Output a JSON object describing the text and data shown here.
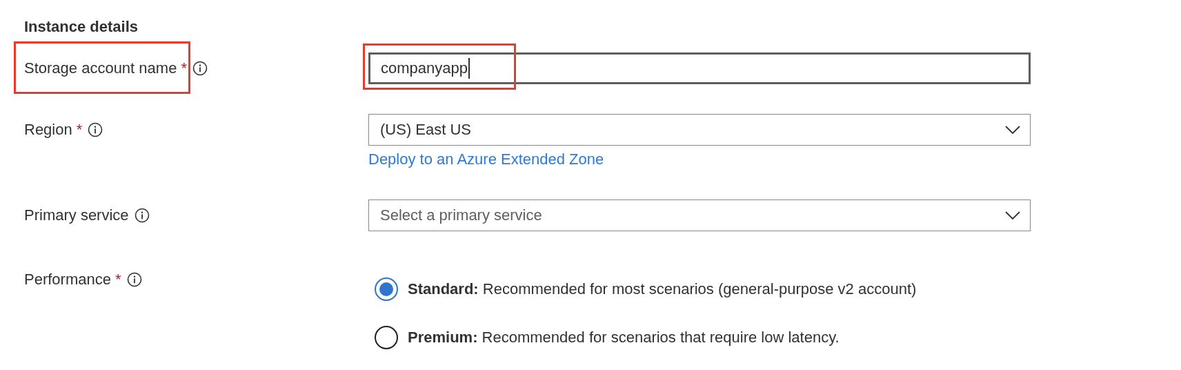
{
  "section_title": "Instance details",
  "fields": [
    {
      "kind": "text",
      "label": "Storage account name",
      "required_mark": "*",
      "value": "companyapp",
      "focused": true,
      "label_highlighted": true,
      "field_highlighted": true
    },
    {
      "kind": "dropdown",
      "label": "Region",
      "required_mark": "*",
      "value": "(US) East US",
      "link": "Deploy to an Azure Extended Zone",
      "label_highlighted": false,
      "field_highlighted": false
    },
    {
      "kind": "dropdown",
      "label": "Primary service",
      "placeholder": "Select a primary service",
      "label_highlighted": false,
      "field_highlighted": false
    },
    {
      "kind": "radio",
      "label": "Performance",
      "required_mark": "*",
      "label_highlighted": false,
      "field_highlighted": false,
      "options": [
        {
          "text": "**Standard:** Recommended for most scenarios (general-purpose v2 account)",
          "selected": true
        },
        {
          "text": "**Premium:** Recommended for scenarios that require low latency.",
          "selected": false
        }
      ]
    }
  ]
}
